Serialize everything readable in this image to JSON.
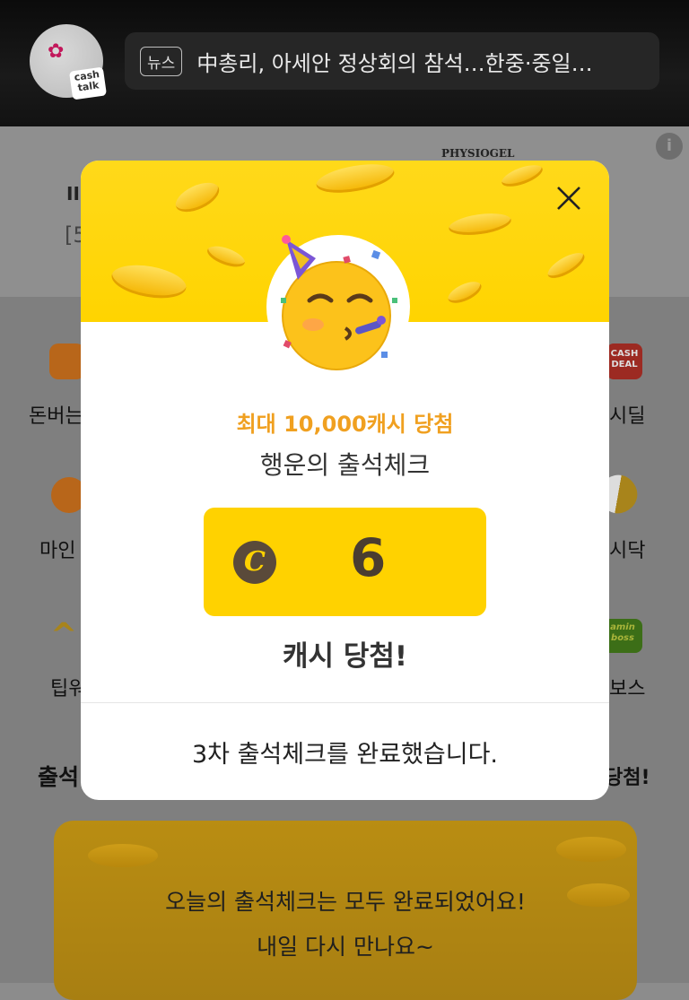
{
  "header": {
    "avatar_badge": "cash\ntalk",
    "news_tag": "뉴스",
    "news_headline": "中총리, 아세안 정상회의 참석…한중·중일…"
  },
  "ad": {
    "brand": "PHYSIOGEL",
    "info": "i",
    "title_fragment": "II",
    "bracket_fragment": "[5"
  },
  "background_menu": {
    "row1_left": "돈버는",
    "row1_right": "시딜",
    "row1_right_icon_text": "CASH\nDEAL",
    "row2_left": "마인",
    "row2_right": "시닥",
    "row3_left": "팁워",
    "row3_right": "보스",
    "row3_right_icon_text": "amin\nboss",
    "section_left": "출석",
    "section_right": "당첨!"
  },
  "banner": {
    "line1": "오늘의 출석체크는 모두 완료되었어요!",
    "line2": "내일 다시 만나요~"
  },
  "modal": {
    "subtitle": "최대 10,000캐시 당첨",
    "title": "행운의 출석체크",
    "coin_symbol": "C",
    "prize_value": "6",
    "won_text": "캐시 당첨!",
    "completion_message": "3차 출석체크를 완료했습니다."
  },
  "colors": {
    "accent_yellow": "#ffd200",
    "subtitle_orange": "#f0a020"
  }
}
